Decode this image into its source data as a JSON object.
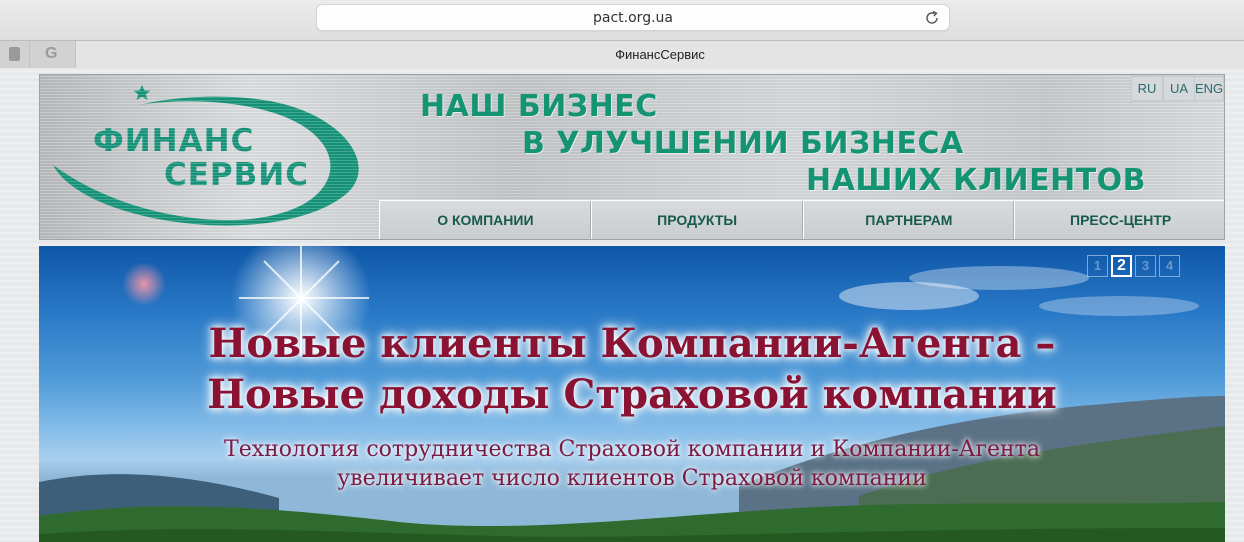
{
  "browser": {
    "url": "pact.org.ua",
    "tab_title": "ФинансСервис",
    "pinned_tab_letter": "G"
  },
  "site": {
    "logo": {
      "line1": "ФИНАНС",
      "line2": "СЕРВИС",
      "color": "#17957a"
    },
    "slogan": {
      "line1": "НАШ БИЗНЕС",
      "line2": "В УЛУЧШЕНИИ БИЗНЕСА",
      "line3": "НАШИХ КЛИЕНТОВ"
    },
    "languages": [
      "RU",
      "UA",
      "ENG"
    ],
    "nav": [
      "О КОМПАНИИ",
      "ПРОДУКТЫ",
      "ПАРТНЕРАМ",
      "ПРЕСС-ЦЕНТР"
    ]
  },
  "banner": {
    "title_line1": "Новые клиенты Компании-Агента –",
    "title_line2": "Новые доходы Страховой компании",
    "subtitle_line1": "Технология сотрудничества Страховой компании и Компании-Агента",
    "subtitle_line2": "увеличивает число клиентов Страховой компании",
    "slides": [
      "1",
      "2",
      "3",
      "4"
    ],
    "active_slide": "2"
  },
  "colors": {
    "brand_green": "#159473",
    "banner_title": "#8a1233",
    "nav_text": "#165a4b"
  }
}
